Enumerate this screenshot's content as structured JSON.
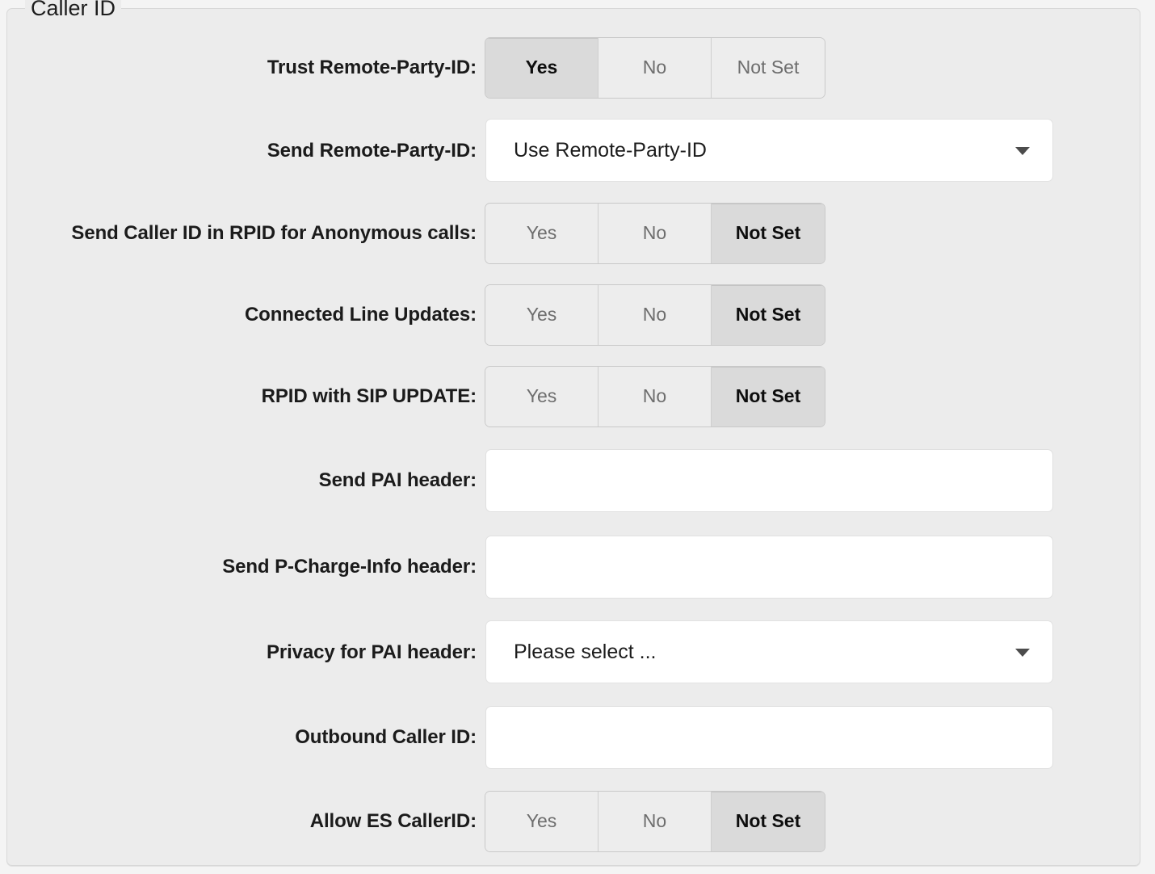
{
  "fieldset": {
    "legend": "Caller ID"
  },
  "options": {
    "yes": "Yes",
    "no": "No",
    "not_set": "Not Set"
  },
  "colors": {
    "panel_background": "#ececec",
    "panel_border": "#d8d8d8",
    "page_background": "#f4f4f4",
    "button_unselected_bg": "#ededed",
    "button_selected_bg": "#dadada",
    "button_unselected_text": "#6d6d6d",
    "button_selected_text": "#0d0d0d",
    "label_text": "#1b1b1b",
    "input_background": "#ffffff",
    "input_border": "#e0e0e0",
    "caret": "#4c4c4c"
  },
  "rows": [
    {
      "label": "Trust Remote-Party-ID:",
      "type": "buttongroup",
      "buttons": [
        {
          "label": "Yes",
          "selected": true
        },
        {
          "label": "No",
          "selected": false
        },
        {
          "label": "Not Set",
          "selected": false
        }
      ]
    },
    {
      "label": "Send Remote-Party-ID:",
      "type": "select",
      "value": "Use Remote-Party-ID",
      "icon": "chevron-down-icon"
    },
    {
      "label": "Send Caller ID in RPID for Anonymous calls:",
      "type": "buttongroup",
      "buttons": [
        {
          "label": "Yes",
          "selected": false
        },
        {
          "label": "No",
          "selected": false
        },
        {
          "label": "Not Set",
          "selected": true
        }
      ]
    },
    {
      "label": "Connected Line Updates:",
      "type": "buttongroup",
      "buttons": [
        {
          "label": "Yes",
          "selected": false
        },
        {
          "label": "No",
          "selected": false
        },
        {
          "label": "Not Set",
          "selected": true
        }
      ]
    },
    {
      "label": "RPID with SIP UPDATE:",
      "type": "buttongroup",
      "buttons": [
        {
          "label": "Yes",
          "selected": false
        },
        {
          "label": "No",
          "selected": false
        },
        {
          "label": "Not Set",
          "selected": true
        }
      ]
    },
    {
      "label": "Send PAI header:",
      "type": "text",
      "value": "",
      "placeholder": ""
    },
    {
      "label": "Send P-Charge-Info header:",
      "type": "text",
      "value": "",
      "placeholder": ""
    },
    {
      "label": "Privacy for PAI header:",
      "type": "select",
      "value": "Please select ...",
      "icon": "chevron-down-icon"
    },
    {
      "label": "Outbound Caller ID:",
      "type": "text",
      "value": "",
      "placeholder": ""
    },
    {
      "label": "Allow ES CallerID:",
      "type": "buttongroup",
      "buttons": [
        {
          "label": "Yes",
          "selected": false
        },
        {
          "label": "No",
          "selected": false
        },
        {
          "label": "Not Set",
          "selected": true
        }
      ]
    }
  ]
}
